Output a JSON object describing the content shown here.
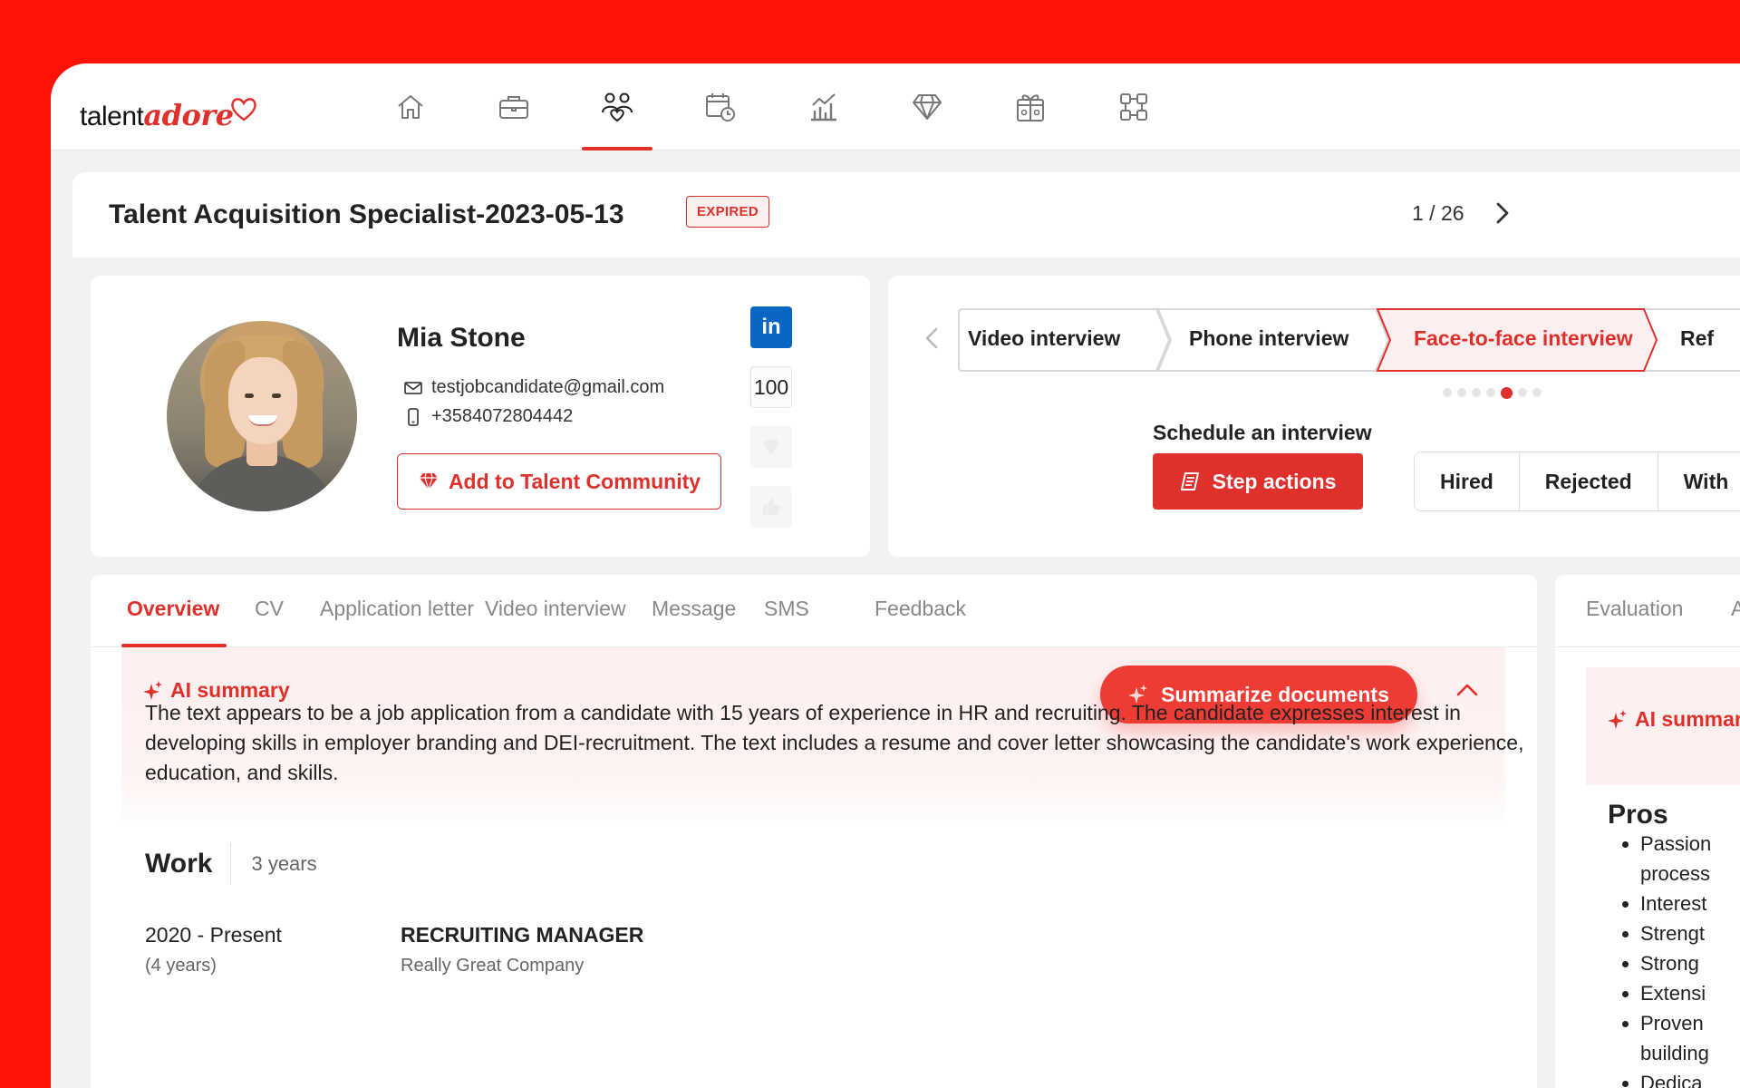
{
  "logo": {
    "part1": "talent",
    "part2": "adore"
  },
  "nav": {
    "items": [
      {
        "name": "home-icon"
      },
      {
        "name": "briefcase-icon"
      },
      {
        "name": "candidates-icon",
        "active": true
      },
      {
        "name": "calendar-clock-icon"
      },
      {
        "name": "analytics-icon"
      },
      {
        "name": "diamond-icon"
      },
      {
        "name": "gift-icon"
      },
      {
        "name": "integrations-icon"
      }
    ]
  },
  "job": {
    "title": "Talent Acquisition Specialist-2023-05-13",
    "status": "EXPIRED",
    "pager": "1 / 26"
  },
  "candidate": {
    "name": "Mia Stone",
    "email": "testjobcandidate@gmail.com",
    "phone": "+3584072804442",
    "add_community": "Add to Talent Community",
    "linkedin": "in",
    "score": "100"
  },
  "pipeline": {
    "stages": [
      {
        "label": "Video interview",
        "active": false
      },
      {
        "label": "Phone interview",
        "active": false
      },
      {
        "label": "Face-to-face interview",
        "active": true
      },
      {
        "label": "Ref",
        "active": false
      }
    ],
    "dots_total": 7,
    "dots_active": 5,
    "schedule_label": "Schedule an interview",
    "step_actions": "Step actions",
    "outcomes": [
      "Hired",
      "Rejected",
      "With"
    ]
  },
  "tabs": [
    "Overview",
    "CV",
    "Application letter",
    "Video interview",
    "Message",
    "SMS",
    "Feedback"
  ],
  "ai": {
    "title": "AI summary",
    "summarize": "Summarize documents",
    "summary": "The text appears to be a job application from a candidate with 15 years of experience in HR and recruiting. The candidate expresses interest in developing skills in employer branding and DEI-recruitment. The text includes a resume and cover letter showcasing the candidate's work experience, education, and skills."
  },
  "work": {
    "title": "Work",
    "years": "3 years",
    "entry": {
      "period": "2020 - Present",
      "duration": "(4 years)",
      "role": "RECRUITING MANAGER",
      "company": "Really Great Company"
    }
  },
  "side": {
    "tabs": [
      "Evaluation",
      "A"
    ],
    "ai_title": "AI summar",
    "pros_title": "Pros",
    "pros": [
      "Passion",
      "process",
      "Interest",
      "Strengt",
      "Strong",
      "Extensi",
      "Proven",
      "building",
      "Dedica"
    ]
  },
  "colors": {
    "brand_red": "#e0302c",
    "background_red": "#ff1208",
    "linkedin_blue": "#0a66c2"
  }
}
